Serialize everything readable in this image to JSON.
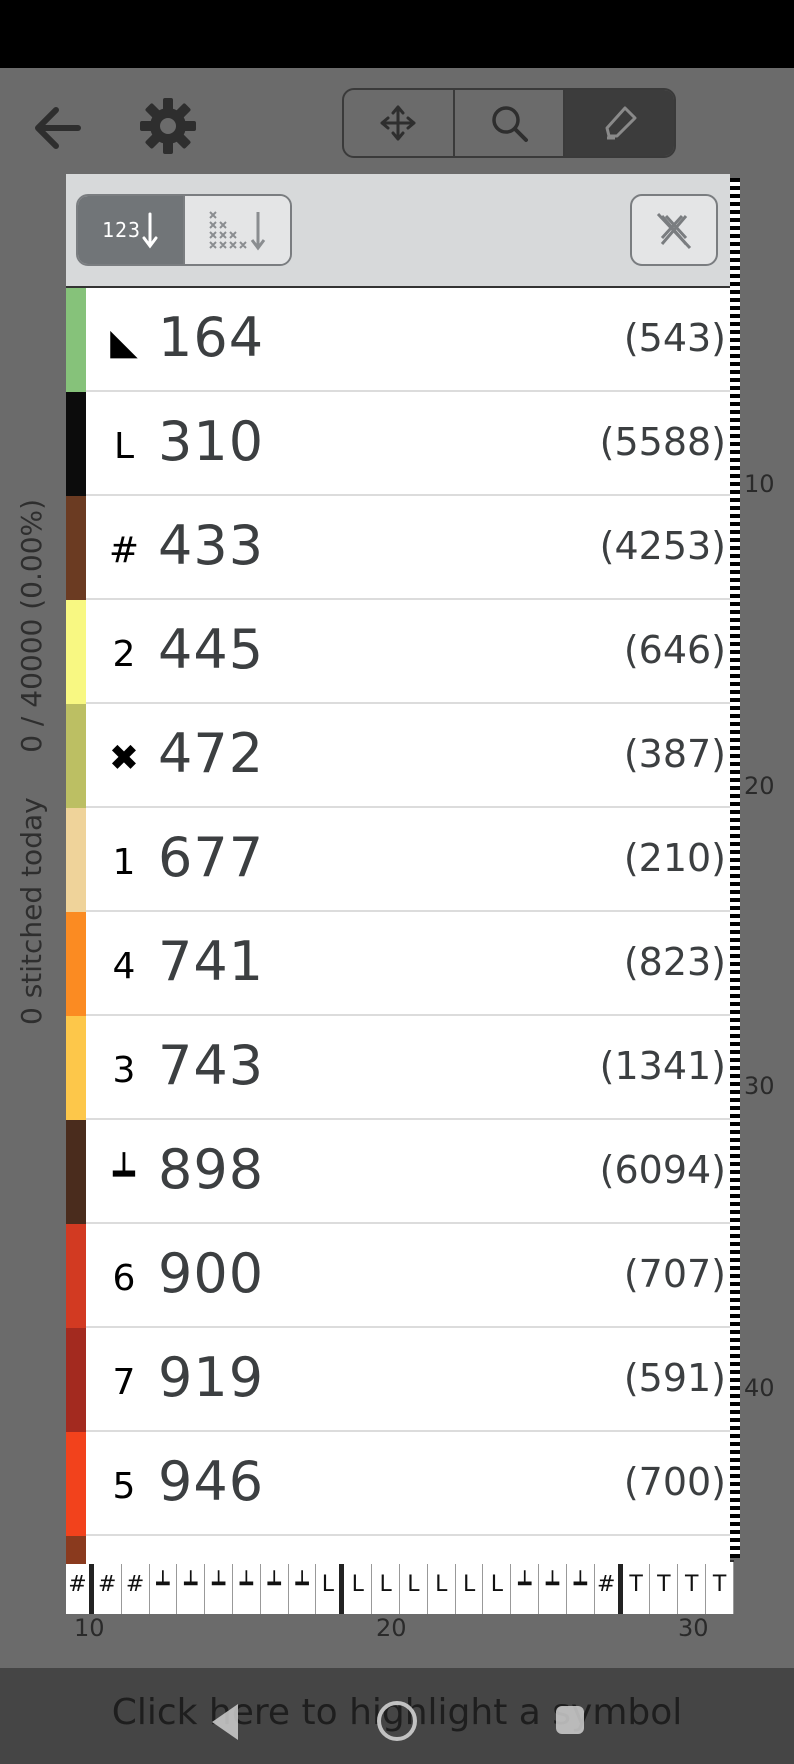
{
  "toolbar": {
    "back_icon": "arrow-left-icon",
    "settings_icon": "gear-icon",
    "modes": [
      {
        "name": "move",
        "icon": "move-arrows-icon"
      },
      {
        "name": "zoom",
        "icon": "magnifier-icon"
      },
      {
        "name": "highlight",
        "icon": "highlighter-icon"
      }
    ]
  },
  "progress": {
    "stitched_today": "0 stitched today",
    "total": "0 / 40000 (0.00%)"
  },
  "panel": {
    "sort_number_label": "123",
    "sort_count_icon": "stitch-count-sort-icon",
    "clear_icon": "clear-stitch-icon"
  },
  "threads": [
    {
      "symbol": "◣",
      "code": "164",
      "count": "(543)",
      "color": "#86c27a"
    },
    {
      "symbol": "L",
      "code": "310",
      "count": "(5588)",
      "color": "#0c0c0c"
    },
    {
      "symbol": "#",
      "code": "433",
      "count": "(4253)",
      "color": "#6b3b22"
    },
    {
      "symbol": "2",
      "code": "445",
      "count": "(646)",
      "color": "#f8f882"
    },
    {
      "symbol": "✖",
      "code": "472",
      "count": "(387)",
      "color": "#bcbf63"
    },
    {
      "symbol": "1",
      "code": "677",
      "count": "(210)",
      "color": "#efd39a"
    },
    {
      "symbol": "4",
      "code": "741",
      "count": "(823)",
      "color": "#fb8b22"
    },
    {
      "symbol": "3",
      "code": "743",
      "count": "(1341)",
      "color": "#fdc74a"
    },
    {
      "symbol": "┷",
      "code": "898",
      "count": "(6094)",
      "color": "#4a2c1d"
    },
    {
      "symbol": "6",
      "code": "900",
      "count": "(707)",
      "color": "#d23a22"
    },
    {
      "symbol": "7",
      "code": "919",
      "count": "(591)",
      "color": "#a32a1f"
    },
    {
      "symbol": "5",
      "code": "946",
      "count": "(700)",
      "color": "#f2421c"
    }
  ],
  "ruler": {
    "right": [
      "10",
      "20",
      "30",
      "40"
    ],
    "bottom": [
      "10",
      "20",
      "30"
    ]
  },
  "grid_strip": [
    "#",
    "#",
    "#",
    "┷",
    "┷",
    "┷",
    "┷",
    "┷",
    "┷",
    "L",
    "L",
    "L",
    "L",
    "L",
    "L",
    "L",
    "┷",
    "┷",
    "┷",
    "#",
    "T",
    "T",
    "T",
    "T"
  ],
  "footer": {
    "hint": "Click here to highlight a symbol"
  }
}
